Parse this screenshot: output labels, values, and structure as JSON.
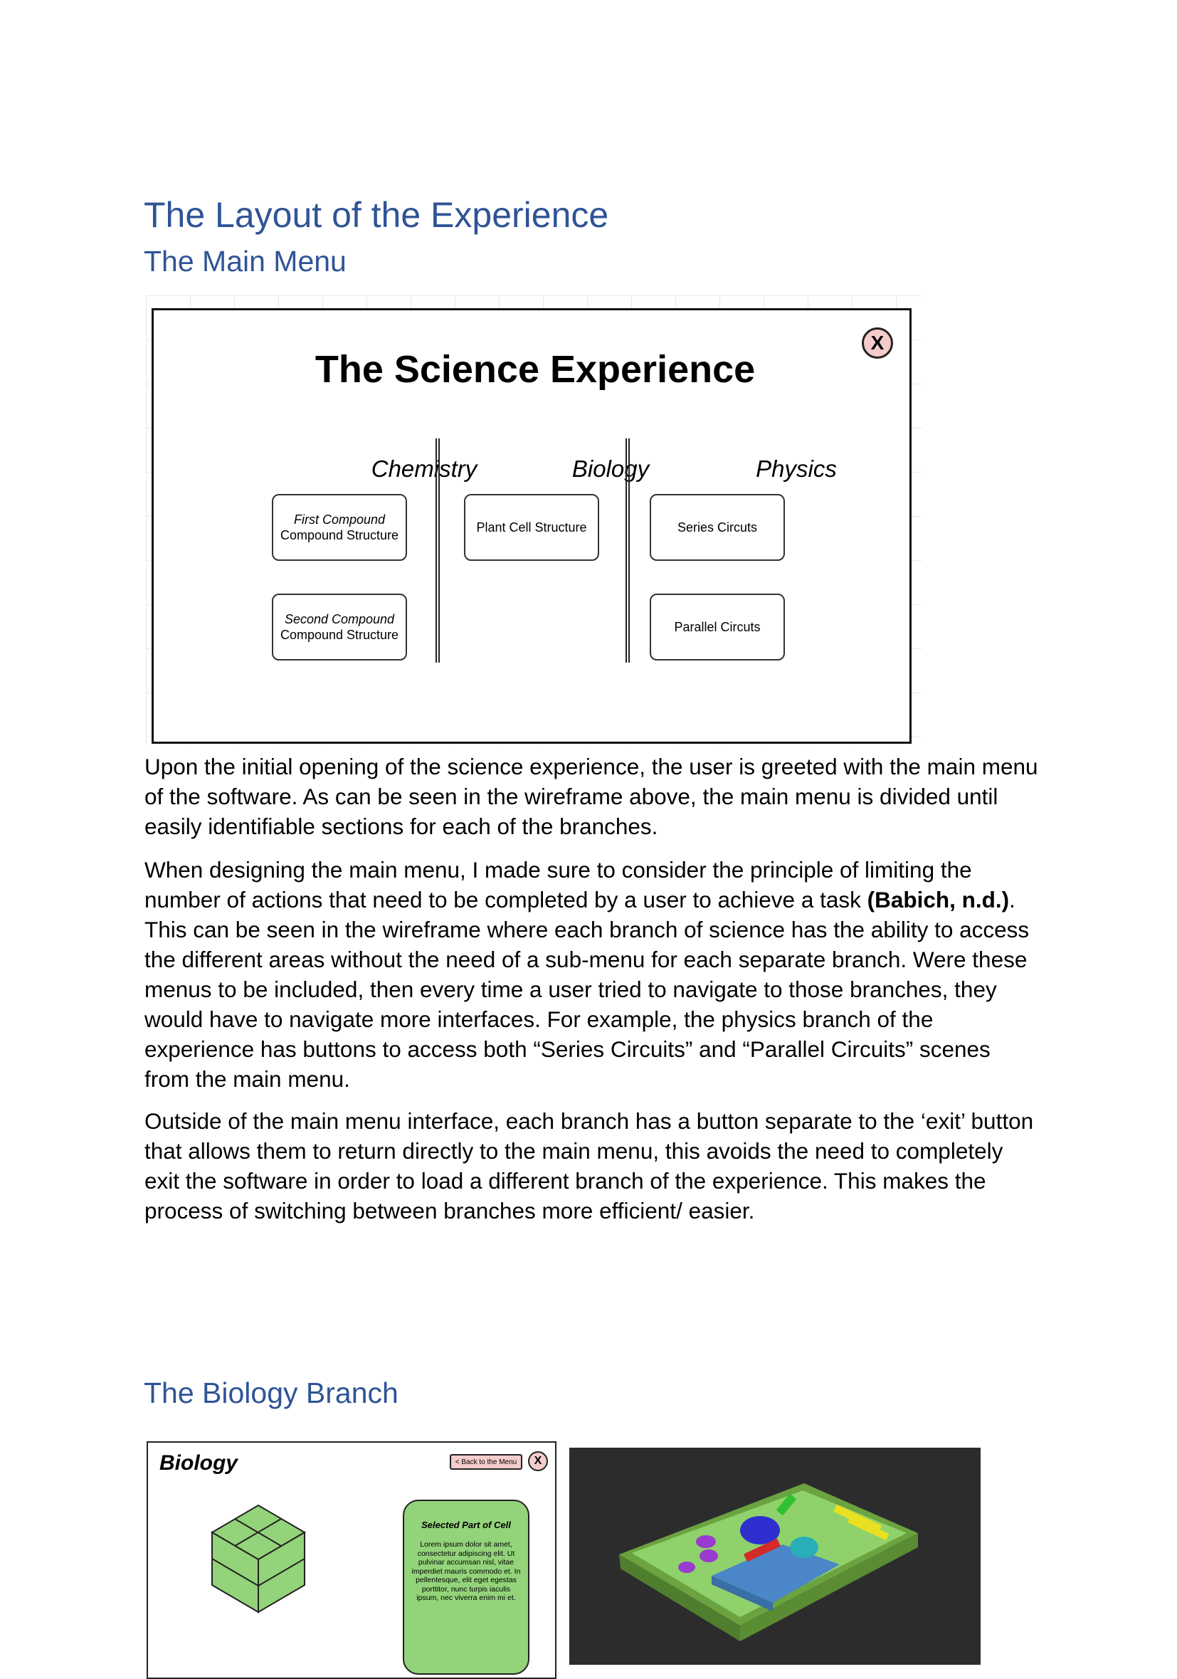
{
  "heading": "The Layout of the Experience",
  "main_menu_section": {
    "heading": "The Main Menu",
    "wireframe": {
      "title": "The Science Experience",
      "close_label": "X",
      "columns": [
        {
          "name": "Chemistry",
          "buttons": [
            {
              "line1": "First Compound",
              "line2": "Compound Structure"
            },
            {
              "line1": "Second Compound",
              "line2": "Compound Structure"
            }
          ]
        },
        {
          "name": "Biology",
          "buttons": [
            {
              "line1": "",
              "line2": "Plant Cell Structure"
            }
          ]
        },
        {
          "name": "Physics",
          "buttons": [
            {
              "line1": "",
              "line2": "Series Circuts"
            },
            {
              "line1": "",
              "line2": "Parallel Circuts"
            }
          ]
        }
      ]
    }
  },
  "paragraphs": {
    "p1": "Upon the initial opening of the science experience, the user is greeted with the main menu of the software. As can be seen in the wireframe above, the main menu is divided until easily identifiable sections for each of the branches.",
    "p2_start": "When designing the main menu, I made sure to consider the principle of limiting the number of actions that need to be completed by a user to achieve a task ",
    "p2_cite": "(Babich, n.d.)",
    "p2_end": ". This can be seen in the wireframe where each branch of science has the ability to access the different areas without the need of a sub-menu for each separate branch. Were these menus to be included, then every time a user tried to navigate to those branches, they would have to navigate more interfaces. For example, the physics branch of the experience has buttons to access both “Series Circuits” and “Parallel Circuits” scenes from the main menu.",
    "p3": "Outside of the main menu interface, each branch has a button separate to the ‘exit’ button that allows them to return directly to the main menu, this avoids the need to completely exit the software in order to load a different branch of the experience. This makes the process of switching between branches more efficient/ easier."
  },
  "biology_section": {
    "heading": "The Biology Branch",
    "wireframe": {
      "title": "Biology",
      "back_label": "< Back to the Menu",
      "close_label": "X",
      "panel_title": "Selected Part of Cell",
      "panel_body": "Lorem ipsum dolor sit amet, consectetur adipiscing elit. Ut pulvinar accumsan nisl, vitae imperdiet mauris commodo et. In pellentesque, elit eget egestas porttitor, nunc turpis iaculis ipsum, nec viverra enim mi et."
    }
  },
  "colors": {
    "heading": "#2f5496",
    "button_red": "#f4cccc",
    "cell_green": "#93d37a"
  }
}
